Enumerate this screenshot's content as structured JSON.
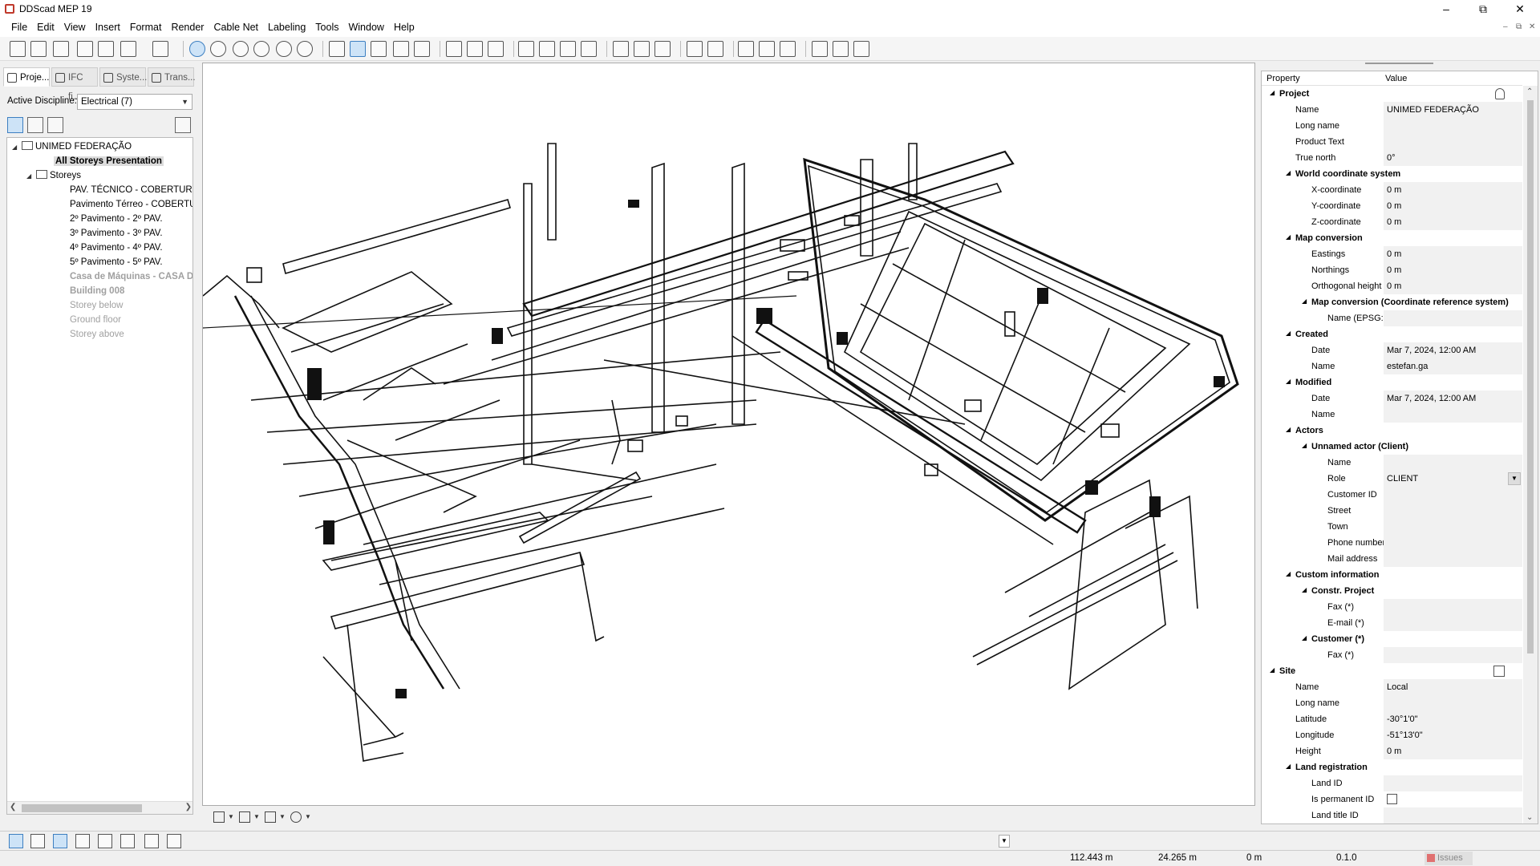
{
  "window": {
    "title": "DDScad MEP 19"
  },
  "menu": [
    "File",
    "Edit",
    "View",
    "Insert",
    "Format",
    "Render",
    "Cable Net",
    "Labeling",
    "Tools",
    "Window",
    "Help"
  ],
  "left_panel": {
    "tabs": [
      "Proje...",
      "IFC fi...",
      "Syste...",
      "Trans..."
    ],
    "discipline_label": "Active Discipline:",
    "discipline_value": "Electrical (7)",
    "tree": {
      "project": "UNIMED FEDERAÇÃO",
      "all_storeys": "All Storeys Presentation",
      "storeys_label": "Storeys",
      "storeys": [
        "PAV. TÉCNICO - COBERTURA C",
        "Pavimento Térreo - COBERTUR",
        "2º Pavimento - 2º PAV.",
        "3º Pavimento - 3º PAV.",
        "4º Pavimento - 4º PAV.",
        "5º Pavimento - 5º PAV."
      ],
      "dim_bold": [
        "Casa de Máquinas - CASA D",
        "Building 008"
      ],
      "dim": [
        "Storey below",
        "Ground floor",
        "Storey above"
      ]
    }
  },
  "properties": {
    "header": {
      "property": "Property",
      "value": "Value"
    },
    "rows": [
      {
        "level": 0,
        "cat": true,
        "name": "Project",
        "icon": "lock-icon"
      },
      {
        "level": 1,
        "name": "Name",
        "value": "UNIMED FEDERAÇÃO"
      },
      {
        "level": 1,
        "name": "Long name",
        "value": ""
      },
      {
        "level": 1,
        "name": "Product Text",
        "value": ""
      },
      {
        "level": 1,
        "name": "True north",
        "value": "0°"
      },
      {
        "level": 1,
        "cat": true,
        "name": "World coordinate system"
      },
      {
        "level": 2,
        "name": "X-coordinate",
        "value": "0 m"
      },
      {
        "level": 2,
        "name": "Y-coordinate",
        "value": "0 m"
      },
      {
        "level": 2,
        "name": "Z-coordinate",
        "value": "0 m"
      },
      {
        "level": 1,
        "cat": true,
        "name": "Map conversion"
      },
      {
        "level": 2,
        "name": "Eastings",
        "value": "0 m"
      },
      {
        "level": 2,
        "name": "Northings",
        "value": "0 m"
      },
      {
        "level": 2,
        "name": "Orthogonal height",
        "value": "0 m"
      },
      {
        "level": 2,
        "cat": true,
        "name": "Map conversion (Coordinate reference system)"
      },
      {
        "level": 3,
        "name": "Name (EPSG:<...",
        "value": ""
      },
      {
        "level": 1,
        "cat": true,
        "name": "Created"
      },
      {
        "level": 2,
        "name": "Date",
        "value": "Mar 7, 2024, 12:00 AM"
      },
      {
        "level": 2,
        "name": "Name",
        "value": "estefan.ga"
      },
      {
        "level": 1,
        "cat": true,
        "name": "Modified"
      },
      {
        "level": 2,
        "name": "Date",
        "value": "Mar 7, 2024, 12:00 AM"
      },
      {
        "level": 2,
        "name": "Name",
        "value": ""
      },
      {
        "level": 1,
        "cat": true,
        "name": "Actors"
      },
      {
        "level": 2,
        "cat": true,
        "name": "Unnamed actor (Client)"
      },
      {
        "level": 3,
        "name": "Name",
        "value": ""
      },
      {
        "level": 3,
        "name": "Role",
        "value": "CLIENT",
        "combo": true
      },
      {
        "level": 3,
        "name": "Customer ID",
        "value": ""
      },
      {
        "level": 3,
        "name": "Street",
        "value": ""
      },
      {
        "level": 3,
        "name": "Town",
        "value": ""
      },
      {
        "level": 3,
        "name": "Phone number",
        "value": ""
      },
      {
        "level": 3,
        "name": "Mail address",
        "value": ""
      },
      {
        "level": 1,
        "cat": true,
        "name": "Custom information"
      },
      {
        "level": 2,
        "cat": true,
        "name": "Constr. Project"
      },
      {
        "level": 3,
        "name": "Fax (*)",
        "value": ""
      },
      {
        "level": 3,
        "name": "E-mail (*)",
        "value": ""
      },
      {
        "level": 2,
        "cat": true,
        "name": "Customer (*)"
      },
      {
        "level": 3,
        "name": "Fax (*)",
        "value": ""
      },
      {
        "level": 0,
        "cat": true,
        "name": "Site",
        "icon": "external-link-icon"
      },
      {
        "level": 1,
        "name": "Name",
        "value": "Local"
      },
      {
        "level": 1,
        "name": "Long name",
        "value": ""
      },
      {
        "level": 1,
        "name": "Latitude",
        "value": "-30°1'0\""
      },
      {
        "level": 1,
        "name": "Longitude",
        "value": "-51°13'0\""
      },
      {
        "level": 1,
        "name": "Height",
        "value": "0 m"
      },
      {
        "level": 1,
        "cat": true,
        "name": "Land registration"
      },
      {
        "level": 2,
        "name": "Land ID",
        "value": ""
      },
      {
        "level": 2,
        "name": "Is permanent ID",
        "checkbox": true
      },
      {
        "level": 2,
        "name": "Land title ID",
        "value": ""
      }
    ]
  },
  "status": {
    "x": "112.443 m",
    "y": "24.265 m",
    "z": "0 m",
    "scale": "0.1.0",
    "issues": "Issues"
  }
}
